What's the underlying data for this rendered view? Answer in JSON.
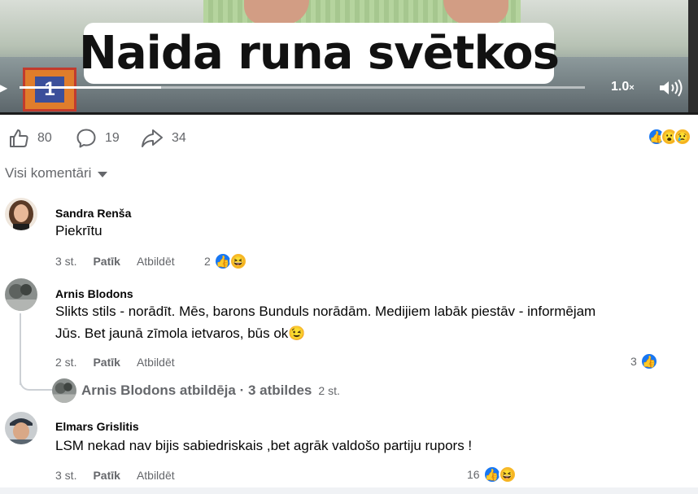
{
  "video": {
    "title": "Naida runa svētkos",
    "logo_glyph": "1",
    "speed_value": "1.0",
    "speed_suffix": "×",
    "progress_fraction": 0.25,
    "icons": [
      "play-icon",
      "volume-icon"
    ]
  },
  "actions": {
    "likes": "80",
    "comments": "19",
    "shares": "34",
    "reaction_emojis": [
      "like",
      "wow",
      "sad"
    ]
  },
  "filter": {
    "label": "Visi komentāri"
  },
  "comments": [
    {
      "author": "Sandra Renša",
      "text": "Piekrītu",
      "time": "3 st.",
      "like_label": "Patīk",
      "reply_label": "Atbildēt",
      "reaction_count": "2",
      "reactions": [
        "like",
        "haha"
      ]
    },
    {
      "author": "Arnis Blodons",
      "text_line1": "Slikts stils - norādīt. Mēs, barons Bunduls norādām. Medijiem labāk piestāv - informējam",
      "text_line2": "Jūs. Bet jaunā zīmola ietvaros, būs ok",
      "text_emoji": "😉",
      "time": "2 st.",
      "like_label": "Patīk",
      "reply_label": "Atbildēt",
      "reaction_count": "3",
      "reactions": [
        "like"
      ],
      "reply_summary": "Arnis Blodons atbildēja · 3 atbildes",
      "reply_time": "2 st."
    },
    {
      "author": "Elmars Grislitis",
      "text": "LSM nekad nav bijis sabiedriskais ,bet agrāk valdošo partiju rupors !",
      "time": "3 st.",
      "like_label": "Patīk",
      "reply_label": "Atbildēt",
      "reaction_count": "16",
      "reactions": [
        "like",
        "haha"
      ]
    }
  ],
  "colors": {
    "like_blue": "#1877f2",
    "meta_gray": "#65676b",
    "text": "#050505",
    "emoji_yellow": "#f7b928"
  }
}
